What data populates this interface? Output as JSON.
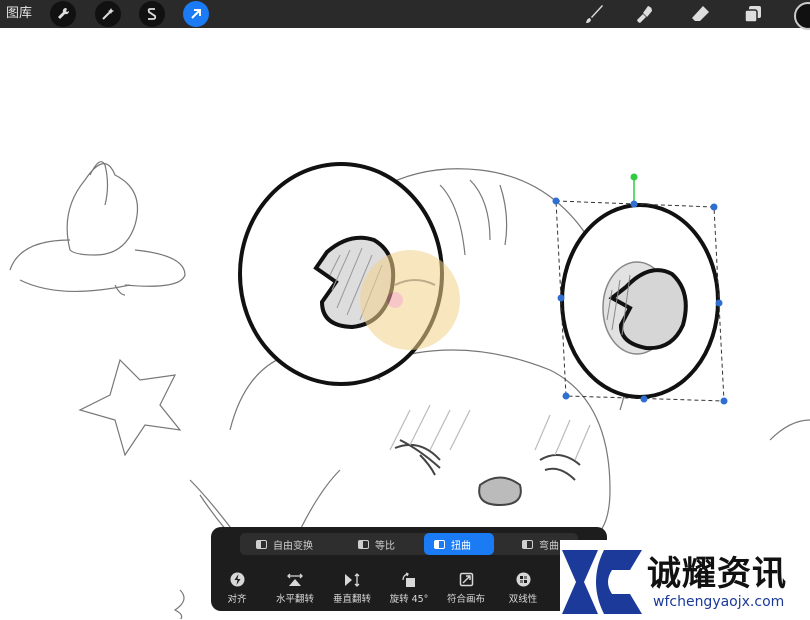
{
  "app": {
    "gallery_label": "图库"
  },
  "toolbar_left": [
    "wrench-icon",
    "magic-wand-icon",
    "selection-s-icon",
    "transform-arrow-icon"
  ],
  "toolbar_right": [
    "brush-icon",
    "smudge-icon",
    "eraser-icon",
    "layers-icon",
    "color-swatch"
  ],
  "transform_modes": [
    {
      "label": "自由变换",
      "icon": "freeform-icon"
    },
    {
      "label": "等比",
      "icon": "uniform-icon"
    },
    {
      "label": "扭曲",
      "icon": "distort-icon",
      "active": true
    },
    {
      "label": "弯曲",
      "icon": "warp-icon"
    }
  ],
  "transform_tools": [
    {
      "label": "对齐",
      "icon": "snap-icon"
    },
    {
      "label": "水平翻转",
      "icon": "flip-horizontal-icon"
    },
    {
      "label": "垂直翻转",
      "icon": "flip-vertical-icon"
    },
    {
      "label": "旋转 45°",
      "icon": "rotate-icon"
    },
    {
      "label": "符合画布",
      "icon": "fit-canvas-icon"
    },
    {
      "label": "双线性",
      "icon": "bilinear-icon"
    }
  ],
  "watermark": {
    "name": "诚耀资讯",
    "url": "wfchengyaojx.com"
  },
  "colors": {
    "accent": "#1a7bf5",
    "toolbar_bg": "#2a2a2a",
    "panel_bg": "#1d1d1d",
    "handle": "#2f6fd1",
    "rotate_handle": "#2ecc40",
    "brand": "#1b3a9a"
  }
}
